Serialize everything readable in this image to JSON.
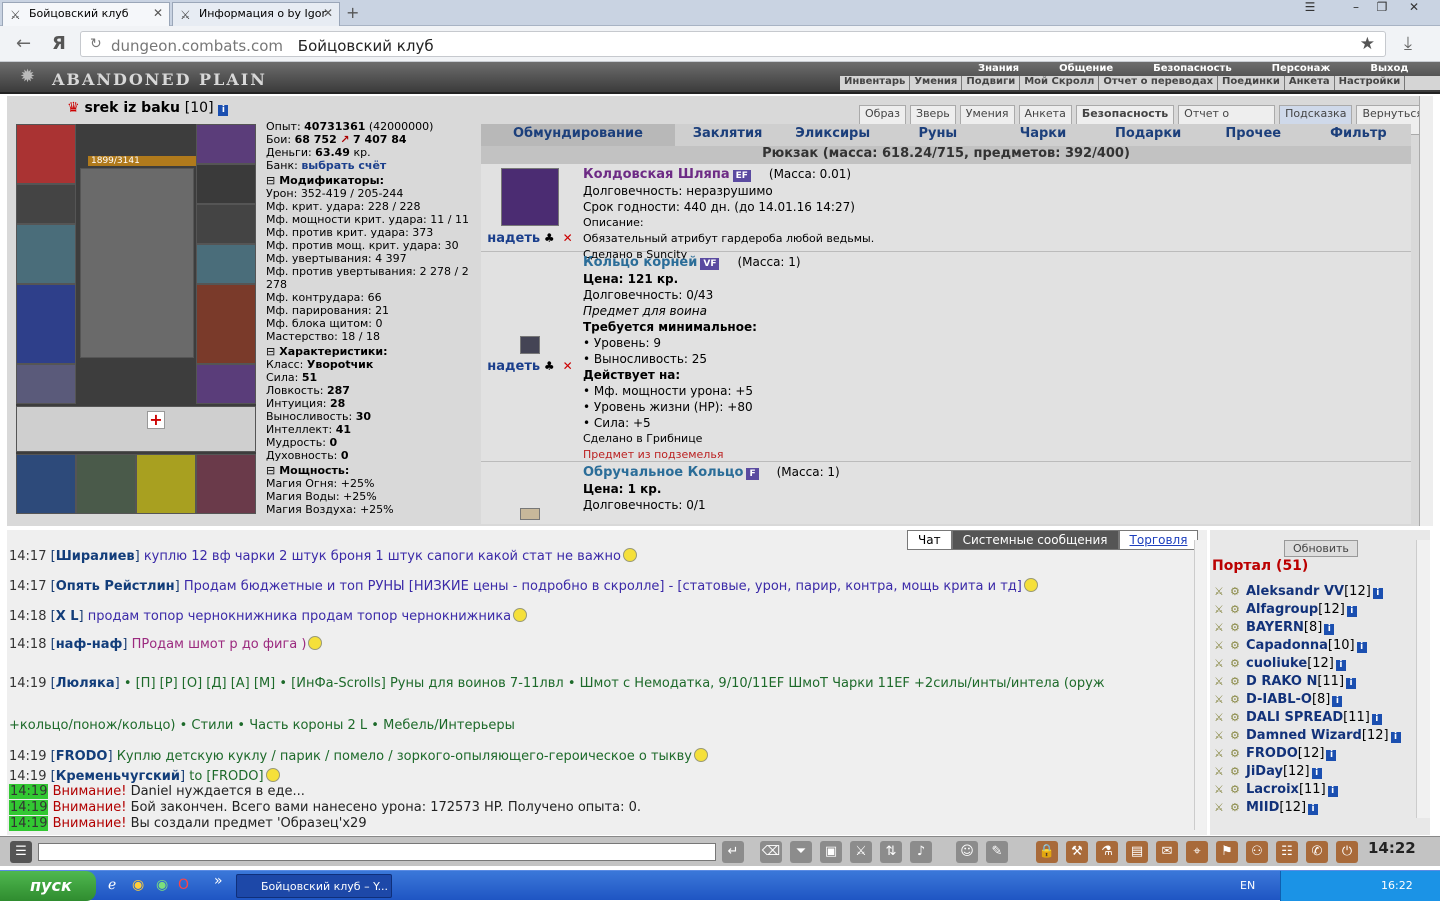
{
  "browser": {
    "tabs": [
      {
        "title": "Бойцовский клуб",
        "active": true
      },
      {
        "title": "Информация о by Igor",
        "active": false
      }
    ],
    "url_domain": "dungeon.combats.com",
    "url_title": "Бойцовский клуб"
  },
  "header": {
    "logo": "ABANDONED PLAIN",
    "top_menu": [
      "Знания",
      "Общение",
      "Безопасность",
      "Персонаж",
      "Выход"
    ],
    "sub_menu": [
      "Инвентарь",
      "Умения",
      "Подвиги",
      "Мой Скролл",
      "Отчет о переводах",
      "Поединки",
      "Анкета",
      "Настройки"
    ]
  },
  "character": {
    "name": "srek iz baku",
    "level": "[10]",
    "hp": "1899/3141",
    "stats": [
      {
        "label": "Опыт:",
        "value": "40731361",
        "extra": "(42000000)"
      },
      {
        "label": "Бои:",
        "value": "68 752",
        "extra": "7 407   84"
      },
      {
        "label": "Деньги:",
        "value": "63.49",
        "extra": "кр."
      },
      {
        "label": "Банк:",
        "link": "выбрать счёт"
      }
    ],
    "sections": [
      {
        "title": "Модификаторы:",
        "rows": [
          {
            "label": "Урон:",
            "value": "352-419 / 205-244"
          },
          {
            "label": "Мф. крит. удара:",
            "value": "228 / 228"
          },
          {
            "label": "Мф. мощности крит. удара:",
            "value": "11 / 11"
          },
          {
            "label": "Мф. против крит. удара:",
            "value": "373"
          },
          {
            "label": "Мф. против мощ. крит. удара:",
            "value": "30"
          },
          {
            "label": "Мф. увертывания:",
            "value": "4 397"
          },
          {
            "label": "Мф. против увертывания:",
            "value": "2 278 / 2 278"
          },
          {
            "label": "Мф. контрудара:",
            "value": "66"
          },
          {
            "label": "Мф. парирования:",
            "value": "21"
          },
          {
            "label": "Мф. блока щитом:",
            "value": "0"
          },
          {
            "label": "Мастерство:",
            "value": "18 / 18"
          }
        ]
      },
      {
        "title": "Характеристики:",
        "rows": [
          {
            "label": "Класс:",
            "value": "Увороtчик"
          },
          {
            "label": "Сила:",
            "value": "51"
          },
          {
            "label": "Ловкость:",
            "value": "287"
          },
          {
            "label": "Интуиция:",
            "value": "28"
          },
          {
            "label": "Выносливость:",
            "value": "30"
          },
          {
            "label": "Интеллект:",
            "value": "41"
          },
          {
            "label": "Мудрость:",
            "value": "0"
          },
          {
            "label": "Духовность:",
            "value": "0"
          }
        ]
      },
      {
        "title": "Мощность:",
        "rows": [
          {
            "label": "Магия Огня:",
            "value": "+25%"
          },
          {
            "label": "Магия Воды:",
            "value": "+25%"
          },
          {
            "label": "Магия Воздуха:",
            "value": "+25%"
          }
        ]
      }
    ]
  },
  "panel_buttons": [
    "Образ",
    "Зверь",
    "Умения",
    "Анкета",
    "Безопасность",
    "Отчет о переводах",
    "Подсказка",
    "Вернуться"
  ],
  "categories": [
    "Обмундирование",
    "Заклятия",
    "Эликсиры",
    "Руны",
    "Чарки",
    "Подарки",
    "Прочее",
    "Фильтр"
  ],
  "backpack": "Рюкзак (масса: 618.24/715, предметов: 392/400)",
  "items": [
    {
      "name": "Колдовская Шляпа",
      "tag": "EF",
      "mass": "(Масса: 0.01)",
      "lines": [
        "Долговечность: неразрушимо",
        "Срок годности: 440 дн. (до 14.01.16 14:27)",
        "Описание:",
        "Обязательный атрибут гардероба любой ведьмы.",
        "Сделано в Suncity"
      ],
      "action": "надеть"
    },
    {
      "name": "Кольцо корней",
      "tag": "VF",
      "mass": "(Масса: 1)",
      "lines": [
        "Цена: 121 кр.",
        "Долговечность: 0/43",
        "Предмет для воина",
        "Требуется минимальное:",
        "• Уровень: 9",
        "• Выносливость: 25",
        "Действует на:",
        "• Мф. мощности урона: +5",
        "• Уровень жизни (HP): +80",
        "• Сила: +5",
        "Сделано в Грибнице"
      ],
      "red": "Предмет из подземелья",
      "action": "надеть"
    },
    {
      "name": "Обручальное Кольцо",
      "tag": "F",
      "mass": "(Масса: 1)",
      "lines": [
        "Цена: 1 кр.",
        "Долговечность: 0/1"
      ]
    }
  ],
  "chat": {
    "tabs": [
      "Чат",
      "Системные сообщения",
      "Торговля"
    ],
    "lines": [
      {
        "t": "14:17",
        "n": "Ширалиев",
        "m": "куплю 12 вф чарки 2 штук броня 1 штук сапоги какой стат не важно",
        "c": "m2"
      },
      {
        "t": "14:17",
        "n": "Опять Рейстлин",
        "m": "Продам бюджетные и топ РУНЫ [НИЗКИЕ цены - подробно в скролле] - [статовые, урон, парир, контра, мощь крита и тд]",
        "c": "m2"
      },
      {
        "t": "14:18",
        "n": "X L",
        "m": "продам топор чернокнижника     продам топор чернокнижника",
        "c": "m2"
      },
      {
        "t": "14:18",
        "n": "наф-наф",
        "m": "ПРодам шмот р до фига )",
        "c": "m3"
      },
      {
        "t": "14:19",
        "n": "Люляка",
        "m": "• [П] [Р] [О] [Д] [А] [М] • [ИнФа-Scrolls]   Руны для воинов 7-11лвл • Шмот с Немодатка, 9/10/11EF ШмоТ    Чарки 11EF +2силы/инты/интела (оруж",
        "c": "m"
      },
      {
        "t": "",
        "n": "",
        "m": "+кольцо/понож/кольцо) • Стили • Часть короны 2 L • Мебель/Интерьеры",
        "c": "m"
      },
      {
        "t": "14:19",
        "n": "FRODO",
        "m": "Куплю детскую куклу / парик / помело / зоркого-опыляющего-героическое о тыкву",
        "c": "m"
      },
      {
        "t": "14:19",
        "n": "Кременьчугский",
        "m": "to [FRODO]",
        "c": "m"
      }
    ],
    "system": [
      {
        "t": "14:19",
        "a": "Внимание!",
        "m": "Daniel нуждается в еде..."
      },
      {
        "t": "14:19",
        "a": "Внимание!",
        "m": "Бой закончен. Всего вами нанесено урона: 172573 HP. Получено опыта: 0."
      },
      {
        "t": "14:19",
        "a": "Внимание!",
        "m": "Вы создали предмет 'Образец'x29"
      }
    ]
  },
  "portal": {
    "refresh": "Обновить",
    "title": "Портал (51)",
    "players": [
      {
        "n": "Aleksandr VV",
        "l": "[12]"
      },
      {
        "n": "Alfagroup",
        "l": "[12]"
      },
      {
        "n": "BAYERN",
        "l": "[8]"
      },
      {
        "n": "Capadonna",
        "l": "[10]"
      },
      {
        "n": "cuoliuke",
        "l": "[12]"
      },
      {
        "n": "D RAKO N",
        "l": "[11]"
      },
      {
        "n": "D-IABL-O",
        "l": "[8]"
      },
      {
        "n": "DALI SPREAD",
        "l": "[11]"
      },
      {
        "n": "Damned Wizard",
        "l": "[12]"
      },
      {
        "n": "FRODO",
        "l": "[12]"
      },
      {
        "n": "JiDay",
        "l": "[12]"
      },
      {
        "n": "Lacroix",
        "l": "[11]"
      },
      {
        "n": "MIID",
        "l": "[12]"
      }
    ]
  },
  "clock": "14:22",
  "taskbar": {
    "start": "пуск",
    "task": "Бойцовский клуб – Y...",
    "lang": "EN",
    "time": "16:22"
  }
}
